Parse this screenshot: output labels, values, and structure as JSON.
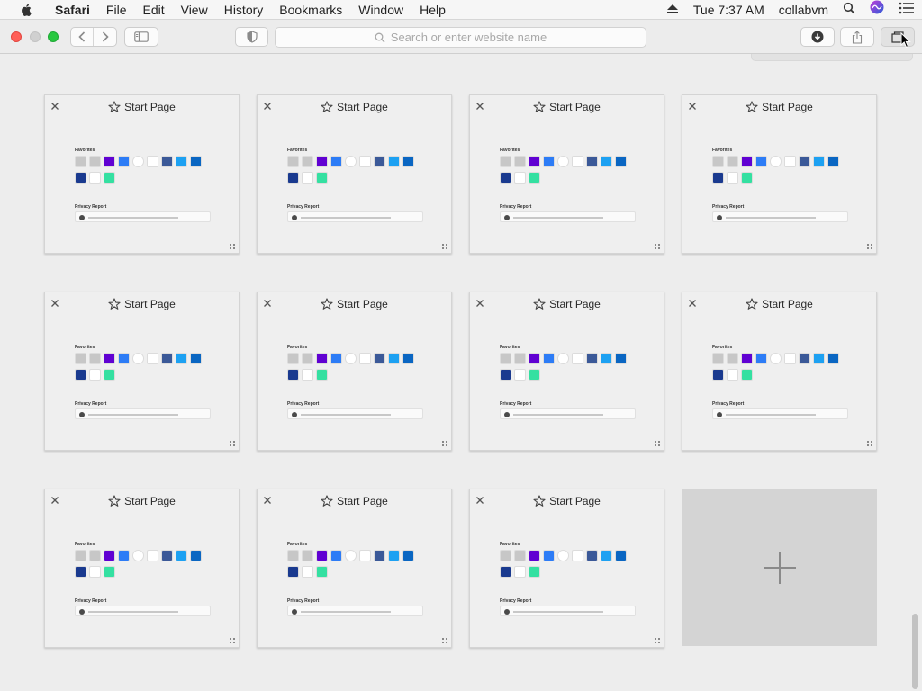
{
  "menubar": {
    "items": [
      "Safari",
      "File",
      "Edit",
      "View",
      "History",
      "Bookmarks",
      "Window",
      "Help"
    ],
    "clock": "Tue 7:37 AM",
    "user": "collabvm"
  },
  "toolbar": {
    "url_placeholder": "Search or enter website name"
  },
  "tabs": [
    {
      "title": "Start Page"
    },
    {
      "title": "Start Page"
    },
    {
      "title": "Start Page"
    },
    {
      "title": "Start Page"
    },
    {
      "title": "Start Page"
    },
    {
      "title": "Start Page"
    },
    {
      "title": "Start Page"
    },
    {
      "title": "Start Page"
    },
    {
      "title": "Start Page"
    },
    {
      "title": "Start Page"
    },
    {
      "title": "Start Page"
    }
  ],
  "thumbnail": {
    "favorites_label": "Favorites",
    "privacy_label": "Privacy Report",
    "favorites_row1_colors": [
      "#c7c7c7",
      "#c7c7c7",
      "#6001d2",
      "#2d7cf6",
      "#ffffff",
      "#ffffff",
      "#3b5998",
      "#1da1f2",
      "#0a66c2"
    ],
    "favorites_row2_colors": [
      "#1a3a8f",
      "#ffffff",
      "#34e0a1"
    ]
  },
  "colors": {
    "close": "#ff5f57",
    "minimize": "#d0d0d0",
    "zoom": "#28c840"
  }
}
